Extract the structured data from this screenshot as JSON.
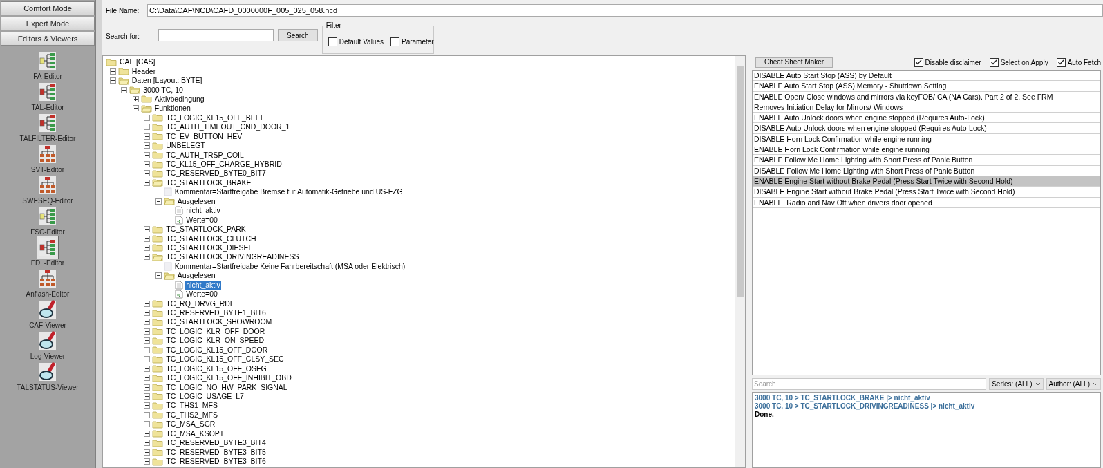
{
  "sidebar": {
    "modes": [
      {
        "label": "Comfort Mode"
      },
      {
        "label": "Expert Mode"
      },
      {
        "label": "Editors & Viewers"
      }
    ],
    "tools": [
      {
        "label": "FA-Editor",
        "kind": "tree-yellow",
        "selected": false
      },
      {
        "label": "TAL-Editor",
        "kind": "tree-red",
        "selected": false
      },
      {
        "label": "TALFILTER-Editor",
        "kind": "tree-red",
        "selected": false
      },
      {
        "label": "SVT-Editor",
        "kind": "hierarchy",
        "selected": false
      },
      {
        "label": "SWESEQ-Editor",
        "kind": "hierarchy",
        "selected": false
      },
      {
        "label": "FSC-Editor",
        "kind": "tree-yellow",
        "selected": false
      },
      {
        "label": "FDL-Editor",
        "kind": "tree-red",
        "selected": true
      },
      {
        "label": "Anflash-Editor",
        "kind": "hierarchy",
        "selected": false
      },
      {
        "label": "CAF-Viewer",
        "kind": "viewer",
        "selected": false
      },
      {
        "label": "Log-Viewer",
        "kind": "viewer",
        "selected": false
      },
      {
        "label": "TALSTATUS-Viewer",
        "kind": "viewer",
        "selected": false
      }
    ]
  },
  "file": {
    "label": "File Name:",
    "value": "C:\\Data\\CAF\\NCD\\CAFD_0000000F_005_025_058.ncd"
  },
  "search": {
    "label": "Search for:",
    "button": "Search"
  },
  "filter": {
    "title": "Filter",
    "options": [
      {
        "label": "Default Values",
        "checked": false
      },
      {
        "label": "Parameter",
        "checked": false
      }
    ]
  },
  "tree": {
    "label": "CAF [CAS]",
    "kind": "root",
    "selected": false,
    "children": [
      {
        "label": "Header",
        "kind": "folder",
        "expanded": false,
        "selected": false
      },
      {
        "label": "Daten [Layout: BYTE]",
        "kind": "folder",
        "expanded": true,
        "selected": false,
        "children": [
          {
            "label": "3000 TC, 10",
            "kind": "folder",
            "expanded": true,
            "selected": false,
            "children": [
              {
                "label": "Aktivbedingung",
                "kind": "folder",
                "expanded": false,
                "selected": false
              },
              {
                "label": "Funktionen",
                "kind": "folder",
                "expanded": true,
                "selected": false,
                "children": [
                  {
                    "label": "TC_LOGIC_KL15_OFF_BELT",
                    "kind": "folder",
                    "expanded": false,
                    "selected": false
                  },
                  {
                    "label": "TC_AUTH_TIMEOUT_CND_DOOR_1",
                    "kind": "folder",
                    "expanded": false,
                    "selected": false
                  },
                  {
                    "label": "TC_EV_BUTTON_HEV",
                    "kind": "folder",
                    "expanded": false,
                    "selected": false
                  },
                  {
                    "label": "UNBELEGT",
                    "kind": "folder",
                    "expanded": false,
                    "selected": false
                  },
                  {
                    "label": "TC_AUTH_TRSP_COIL",
                    "kind": "folder",
                    "expanded": false,
                    "selected": false
                  },
                  {
                    "label": "TC_KL15_OFF_CHARGE_HYBRID",
                    "kind": "folder",
                    "expanded": false,
                    "selected": false
                  },
                  {
                    "label": "TC_RESERVED_BYTE0_BIT7",
                    "kind": "folder",
                    "expanded": false,
                    "selected": false
                  },
                  {
                    "label": "TC_STARTLOCK_BRAKE",
                    "kind": "folder",
                    "expanded": true,
                    "selected": false,
                    "children": [
                      {
                        "label": "Kommentar=Startfreigabe Bremse für Automatik-Getriebe und US-FZG",
                        "kind": "note",
                        "selected": false
                      },
                      {
                        "label": "Ausgelesen",
                        "kind": "folder",
                        "expanded": true,
                        "selected": false,
                        "children": [
                          {
                            "label": "nicht_aktiv",
                            "kind": "doc",
                            "selected": false
                          },
                          {
                            "label": "Werte=00",
                            "kind": "value",
                            "selected": false
                          }
                        ]
                      }
                    ]
                  },
                  {
                    "label": "TC_STARTLOCK_PARK",
                    "kind": "folder",
                    "expanded": false,
                    "selected": false
                  },
                  {
                    "label": "TC_STARTLOCK_CLUTCH",
                    "kind": "folder",
                    "expanded": false,
                    "selected": false
                  },
                  {
                    "label": "TC_STARTLOCK_DIESEL",
                    "kind": "folder",
                    "expanded": false,
                    "selected": false
                  },
                  {
                    "label": "TC_STARTLOCK_DRIVINGREADINESS",
                    "kind": "folder",
                    "expanded": true,
                    "selected": false,
                    "children": [
                      {
                        "label": "Kommentar=Startfreigabe Keine Fahrbereitschaft (MSA oder Elektrisch)",
                        "kind": "note",
                        "selected": false
                      },
                      {
                        "label": "Ausgelesen",
                        "kind": "folder",
                        "expanded": true,
                        "selected": false,
                        "children": [
                          {
                            "label": "nicht_aktiv",
                            "kind": "doc",
                            "selected": true
                          },
                          {
                            "label": "Werte=00",
                            "kind": "value",
                            "selected": false
                          }
                        ]
                      }
                    ]
                  },
                  {
                    "label": "TC_RQ_DRVG_RDI",
                    "kind": "folder",
                    "expanded": false,
                    "selected": false
                  },
                  {
                    "label": "TC_RESERVED_BYTE1_BIT6",
                    "kind": "folder",
                    "expanded": false,
                    "selected": false
                  },
                  {
                    "label": "TC_STARTLOCK_SHOWROOM",
                    "kind": "folder",
                    "expanded": false,
                    "selected": false
                  },
                  {
                    "label": "TC_LOGIC_KLR_OFF_DOOR",
                    "kind": "folder",
                    "expanded": false,
                    "selected": false
                  },
                  {
                    "label": "TC_LOGIC_KLR_ON_SPEED",
                    "kind": "folder",
                    "expanded": false,
                    "selected": false
                  },
                  {
                    "label": "TC_LOGIC_KL15_OFF_DOOR",
                    "kind": "folder",
                    "expanded": false,
                    "selected": false
                  },
                  {
                    "label": "TC_LOGIC_KL15_OFF_CLSY_SEC",
                    "kind": "folder",
                    "expanded": false,
                    "selected": false
                  },
                  {
                    "label": "TC_LOGIC_KL15_OFF_OSFG",
                    "kind": "folder",
                    "expanded": false,
                    "selected": false
                  },
                  {
                    "label": "TC_LOGIC_KL15_OFF_INHIBIT_OBD",
                    "kind": "folder",
                    "expanded": false,
                    "selected": false
                  },
                  {
                    "label": "TC_LOGIC_NO_HW_PARK_SIGNAL",
                    "kind": "folder",
                    "expanded": false,
                    "selected": false
                  },
                  {
                    "label": "TC_LOGIC_USAGE_L7",
                    "kind": "folder",
                    "expanded": false,
                    "selected": false
                  },
                  {
                    "label": "TC_THS1_MFS",
                    "kind": "folder",
                    "expanded": false,
                    "selected": false
                  },
                  {
                    "label": "TC_THS2_MFS",
                    "kind": "folder",
                    "expanded": false,
                    "selected": false
                  },
                  {
                    "label": "TC_MSA_SGR",
                    "kind": "folder",
                    "expanded": false,
                    "selected": false
                  },
                  {
                    "label": "TC_MSA_KSOPT",
                    "kind": "folder",
                    "expanded": false,
                    "selected": false
                  },
                  {
                    "label": "TC_RESERVED_BYTE3_BIT4",
                    "kind": "folder",
                    "expanded": false,
                    "selected": false
                  },
                  {
                    "label": "TC_RESERVED_BYTE3_BIT5",
                    "kind": "folder",
                    "expanded": false,
                    "selected": false
                  },
                  {
                    "label": "TC_RESERVED_BYTE3_BIT6",
                    "kind": "folder",
                    "expanded": false,
                    "selected": false
                  }
                ]
              }
            ]
          }
        ]
      }
    ]
  },
  "cheats": {
    "button": "Cheat Sheet Maker",
    "options": [
      {
        "label": "Disable disclaimer",
        "checked": true
      },
      {
        "label": "Select on Apply",
        "checked": true
      },
      {
        "label": "Auto Fetch",
        "checked": true
      }
    ],
    "items": [
      {
        "label": "DISABLE Auto Start Stop (ASS) by Default",
        "selected": false
      },
      {
        "label": "ENABLE Auto Start Stop (ASS) Memory - Shutdown Setting",
        "selected": false
      },
      {
        "label": "ENABLE Open/ Close windows and mirrors via keyFOB/ CA (NA Cars). Part 2 of 2. See FRM",
        "selected": false
      },
      {
        "label": "Removes Initiation Delay for Mirrors/ Windows",
        "selected": false
      },
      {
        "label": "ENABLE Auto Unlock doors when engine stopped (Requires Auto-Lock)",
        "selected": false
      },
      {
        "label": "DISABLE Auto Unlock doors when engine stopped (Requires Auto-Lock)",
        "selected": false
      },
      {
        "label": "DISABLE Horn Lock Confirmation while engine running",
        "selected": false
      },
      {
        "label": "ENABLE Horn Lock Confirmation while engine running",
        "selected": false
      },
      {
        "label": "ENABLE Follow Me Home Lighting with Short Press of Panic Button",
        "selected": false
      },
      {
        "label": "DISABLE Follow Me Home Lighting with Short Press of Panic Button",
        "selected": false
      },
      {
        "label": "ENABLE Engine Start without Brake Pedal (Press Start Twice with Second Hold)",
        "selected": true
      },
      {
        "label": "DISABLE Engine Start without Brake Pedal (Press Start Twice with Second Hold)",
        "selected": false
      },
      {
        "label": "ENABLE  Radio and Nav Off when drivers door opened",
        "selected": false
      }
    ],
    "search_placeholder": "Search",
    "series": "Series: (ALL)",
    "author": "Author: (ALL)"
  },
  "log": [
    {
      "kind": "path",
      "text": "3000 TC, 10 > TC_STARTLOCK_BRAKE |> nicht_aktiv"
    },
    {
      "kind": "path",
      "text": "3000 TC, 10 > TC_STARTLOCK_DRIVINGREADINESS |> nicht_aktiv"
    },
    {
      "kind": "status",
      "text": "Done."
    }
  ]
}
